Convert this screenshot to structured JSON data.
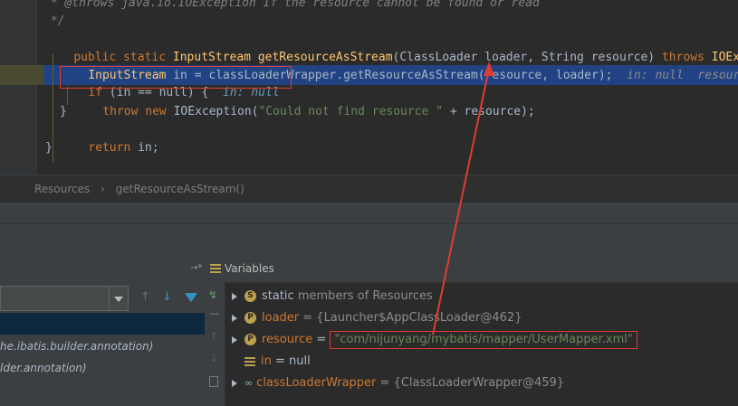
{
  "editor": {
    "comment_throws": " * @throws java.io.IOException If the resource cannot be found or read",
    "comment_end": " */",
    "sig_kw1": "public",
    "sig_kw2": "static",
    "sig_type": "InputStream",
    "sig_name": "getResourceAsStream",
    "sig_params": "(ClassLoader loader, String resource)",
    "sig_throws": "throws",
    "sig_exc": "IOExce",
    "l2_type": "InputStream",
    "l2_rest": " in = classLoaderWrapper.getResourceAsStream(resource, loader);",
    "l2_inline": "  in: null  resource",
    "l3_kw": "if",
    "l3_rest": " (in == null) {",
    "l3_inline": "  in: null",
    "l4_kw1": "throw",
    "l4_kw2": "new",
    "l4_rest": " IOException(",
    "l4_str": "\"Could not find resource \"",
    "l4_end": " + resource);",
    "l5": "}",
    "l6_kw": "return",
    "l6_rest": " in;",
    "l7": "}"
  },
  "breadcrumb": {
    "item1": "Resources",
    "sep": "›",
    "item2": "getResourceAsStream()"
  },
  "frames": {
    "row1": "he.ibatis.builder.annotation)",
    "row2": "lder.annotation)"
  },
  "variables": {
    "title": "Variables",
    "rows": [
      {
        "badge": "S",
        "name": "static",
        "rest": " members of Resources"
      },
      {
        "badge": "P",
        "name": "loader",
        "rest": " = {Launcher$AppClassLoader@462}"
      },
      {
        "badge": "P",
        "name": "resource",
        "eq": " = ",
        "value": "\"com/nijunyang/mybatis/mapper/UserMapper.xml\""
      },
      {
        "badge": "",
        "name": "in",
        "rest": " = null"
      },
      {
        "badge": "",
        "name": "classLoaderWrapper",
        "rest": " = {ClassLoaderWrapper@459}"
      }
    ]
  },
  "colors": {
    "accent_red": "#e03c31",
    "selection": "#214283"
  }
}
